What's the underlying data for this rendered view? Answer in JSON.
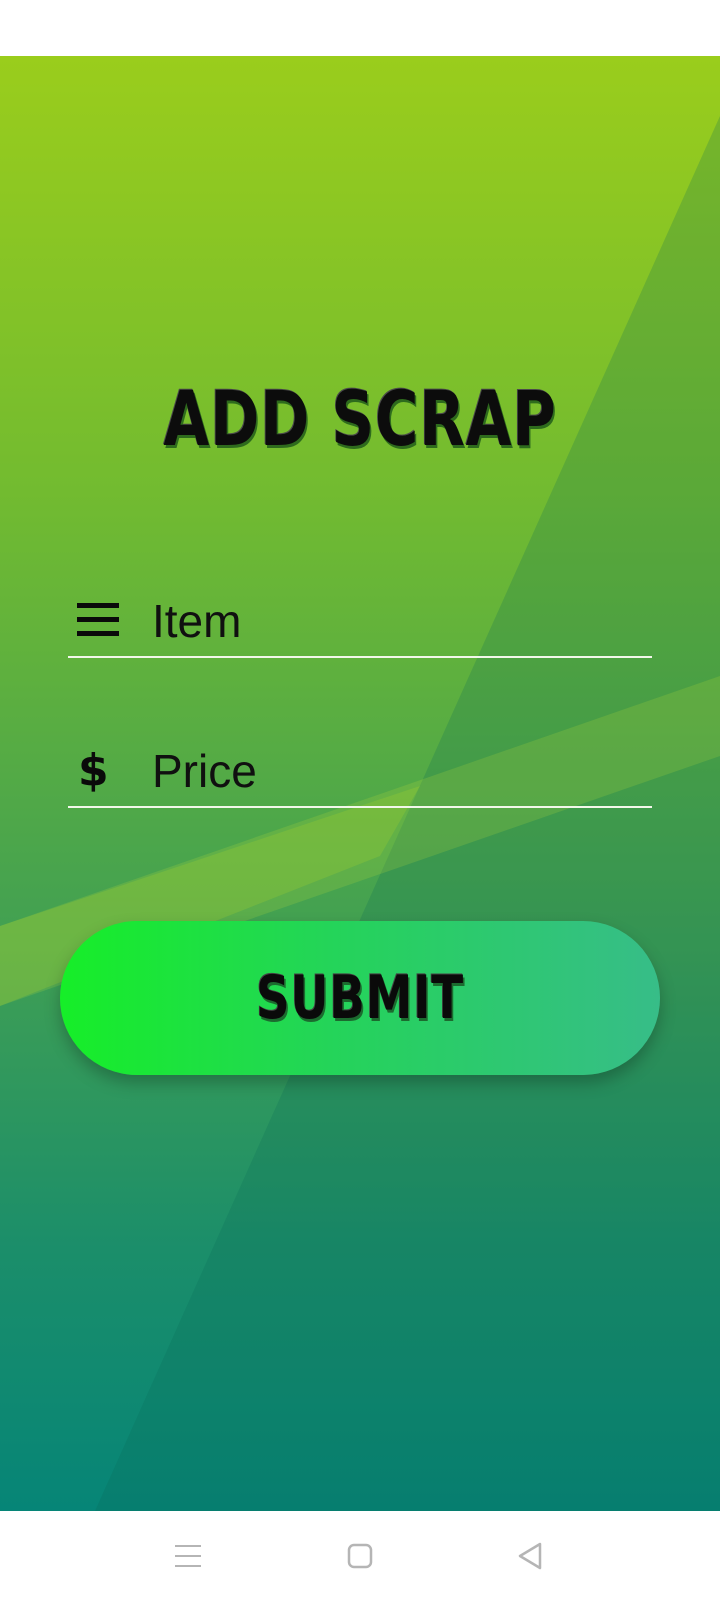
{
  "screen": {
    "title": "ADD SCRAP"
  },
  "form": {
    "item_field": {
      "icon": "menu-lines-icon",
      "placeholder": "Item",
      "value": ""
    },
    "price_field": {
      "icon": "dollar-icon",
      "icon_glyph": "$",
      "placeholder": "Price",
      "value": ""
    },
    "submit_label": "SUBMIT"
  },
  "navigation_bar": {
    "buttons": [
      "menu-icon",
      "home-square-icon",
      "back-triangle-icon"
    ]
  },
  "colors": {
    "background_top": "#9acd1c",
    "background_bottom": "#068577",
    "button_start": "#16ee28",
    "button_end": "#37bd88",
    "text": "#0a0a0a",
    "underline": "#f2f7ea"
  }
}
